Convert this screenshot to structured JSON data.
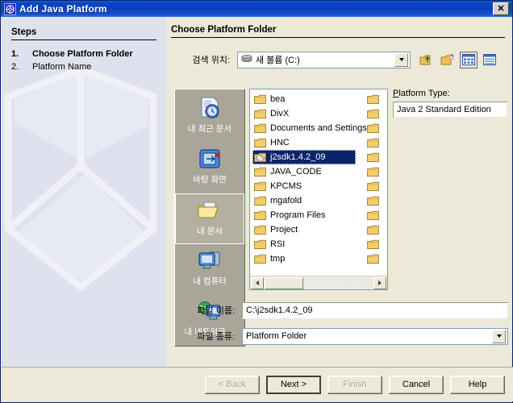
{
  "window": {
    "title": "Add Java Platform",
    "icon": "java-platform-icon",
    "close_label": "✕",
    "accent_title_bg": "#0a3fc0",
    "dialog_bg": "#ece9d8"
  },
  "steps_panel": {
    "heading": "Steps",
    "items": [
      {
        "num": "1.",
        "label": "Choose Platform Folder",
        "active": true
      },
      {
        "num": "2.",
        "label": "Platform Name",
        "active": false
      }
    ],
    "watermark": "wireframe-cube-watermark",
    "bg": "#dfe2ee"
  },
  "content": {
    "title": "Choose Platform Folder",
    "lookin": {
      "label": "검색 위치:",
      "value": "새 볼륨 (C:)",
      "icon": "drive-icon"
    },
    "toolbar": [
      {
        "name": "up-one-level-icon",
        "selected": false
      },
      {
        "name": "new-folder-icon",
        "selected": false
      },
      {
        "name": "list-view-icon",
        "selected": true
      },
      {
        "name": "details-view-icon",
        "selected": false
      }
    ],
    "places": [
      {
        "label": "내 최근 문서",
        "icon": "recent-documents-icon",
        "selected": false
      },
      {
        "label": "바탕 화면",
        "icon": "desktop-icon",
        "selected": false
      },
      {
        "label": "내 문서",
        "icon": "my-documents-icon",
        "selected": true
      },
      {
        "label": "내 컴퓨터",
        "icon": "my-computer-icon",
        "selected": false
      },
      {
        "label": "내 네트워크 ...",
        "icon": "network-places-icon",
        "selected": false
      }
    ],
    "files": {
      "column1": [
        {
          "name": "bea",
          "selected": false
        },
        {
          "name": "DivX",
          "selected": false
        },
        {
          "name": "Documents and Settings",
          "selected": false
        },
        {
          "name": "HNC",
          "selected": false
        },
        {
          "name": "j2sdk1.4.2_09",
          "selected": true
        },
        {
          "name": "JAVA_CODE",
          "selected": false
        },
        {
          "name": "KPCMS",
          "selected": false
        },
        {
          "name": "mgafold",
          "selected": false
        },
        {
          "name": "Program Files",
          "selected": false
        },
        {
          "name": "Project",
          "selected": false
        },
        {
          "name": "RSI",
          "selected": false
        },
        {
          "name": "tmp",
          "selected": false
        }
      ],
      "column2": [
        {
          "name": "",
          "selected": false
        },
        {
          "name": "",
          "selected": false
        },
        {
          "name": "",
          "selected": false
        },
        {
          "name": "",
          "selected": false
        },
        {
          "name": "",
          "selected": false
        },
        {
          "name": "",
          "selected": false
        },
        {
          "name": "",
          "selected": false
        },
        {
          "name": "",
          "selected": false
        },
        {
          "name": "",
          "selected": false
        },
        {
          "name": "",
          "selected": false
        },
        {
          "name": "",
          "selected": false
        },
        {
          "name": "",
          "selected": false
        }
      ],
      "scroll_thumb_pct": 36
    },
    "platform_type": {
      "label_pre": "P",
      "label_post": "latform Type:",
      "value": "Java 2 Standard Edition"
    },
    "file_name": {
      "label": "파일 이름:",
      "value": "C:\\j2sdk1.4.2_09"
    },
    "file_type": {
      "label": "파일 종류:",
      "value": "Platform Folder"
    }
  },
  "buttons": [
    {
      "name": "back-button",
      "label": "< Back",
      "state": "disabled",
      "mnemonic": ""
    },
    {
      "name": "next-button",
      "label": "Next >",
      "state": "default",
      "mnemonic": ""
    },
    {
      "name": "finish-button",
      "label": "Finish",
      "state": "disabled",
      "mnemonic": ""
    },
    {
      "name": "cancel-button",
      "label": "Cancel",
      "state": "normal",
      "mnemonic": ""
    },
    {
      "name": "help-button",
      "label": "Help",
      "state": "normal",
      "mnemonic": "H"
    }
  ]
}
